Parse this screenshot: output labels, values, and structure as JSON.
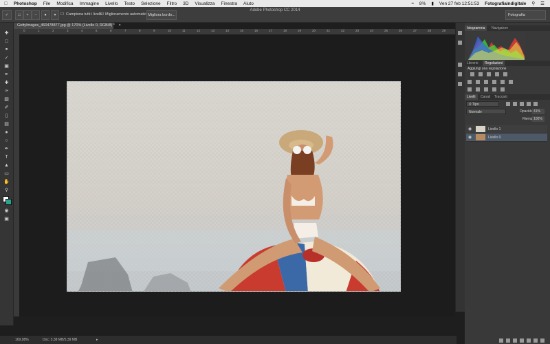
{
  "menubar": {
    "app": "Photoshop",
    "items": [
      "File",
      "Modifica",
      "Immagine",
      "Livello",
      "Testo",
      "Selezione",
      "Filtro",
      "3D",
      "Visualizza",
      "Finestra",
      "Aiuto"
    ],
    "battery": "8%",
    "datetime": "Ven 27 feb  12:51:53",
    "user": "Fotografiaindigitale"
  },
  "window_title": "Adobe Photoshop CC 2014",
  "options_bar": {
    "sample_all_layers": "Campiona tutti i livelli",
    "auto_enhance": "Miglioramento automatico",
    "refine_edge_button": "Migliora bordo...",
    "workspace": "Fotografia"
  },
  "document_tab": "GettyImages_460478877.jpg @ 170% (Livello 0, RGB/8) *",
  "ruler_ticks": [
    "0",
    "1",
    "2",
    "3",
    "4",
    "5",
    "6",
    "7",
    "8",
    "9",
    "10",
    "11",
    "12",
    "13",
    "14",
    "15",
    "16",
    "17",
    "18",
    "19",
    "20",
    "21",
    "22",
    "23",
    "24",
    "25",
    "26",
    "27",
    "28",
    "29"
  ],
  "status": {
    "zoom": "169,98%",
    "doc": "Doc: 3,38 MB/5,39 MB"
  },
  "panels": {
    "histogram_tabs": [
      "Istogramma",
      "Navigatore"
    ],
    "adjust_tabs": [
      "Librerie",
      "Regolazioni"
    ],
    "adjust_title": "Aggiungi una regolazione",
    "layers_tabs": [
      "Livelli",
      "Canali",
      "Tracciati"
    ],
    "kind_filter": "Tipo",
    "blend_mode": "Normale",
    "opacity_label": "Opacità:",
    "opacity_value": "41%",
    "fill_label": "Riemp.:",
    "fill_value": "100%",
    "layers": [
      {
        "name": "Livello 1",
        "selected": false
      },
      {
        "name": "Livello 0",
        "selected": true
      }
    ]
  },
  "colors": {
    "selection_highlight": "#4e5968",
    "foreground": "#ffffff",
    "background_swatch": "#2aa58a"
  }
}
